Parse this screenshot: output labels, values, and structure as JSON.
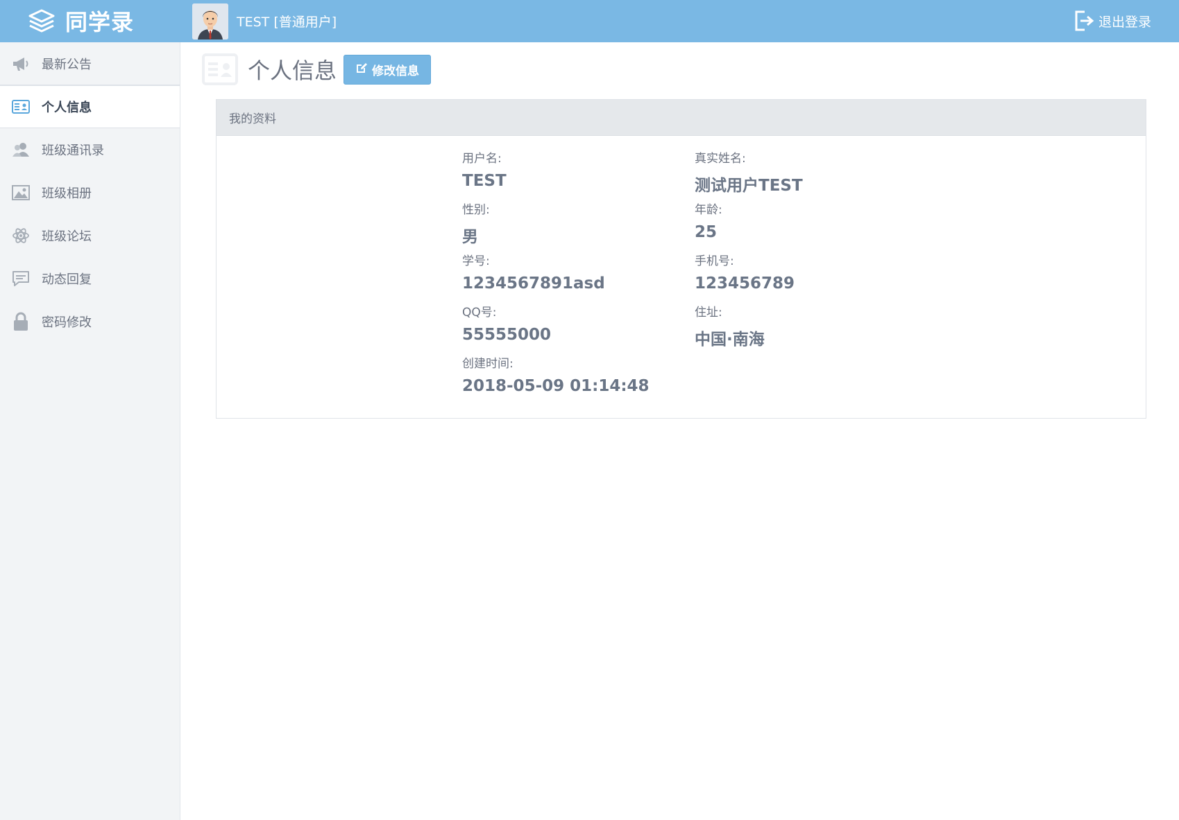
{
  "app": {
    "name": "同学录"
  },
  "header": {
    "user_label": "TEST [普通用户]",
    "logout_label": "退出登录"
  },
  "sidebar": {
    "items": [
      {
        "label": "最新公告",
        "icon": "megaphone-icon"
      },
      {
        "label": "个人信息",
        "icon": "id-card-icon",
        "active": true
      },
      {
        "label": "班级通讯录",
        "icon": "users-icon"
      },
      {
        "label": "班级相册",
        "icon": "image-icon"
      },
      {
        "label": "班级论坛",
        "icon": "atom-icon"
      },
      {
        "label": "动态回复",
        "icon": "comment-icon"
      },
      {
        "label": "密码修改",
        "icon": "lock-icon"
      }
    ]
  },
  "page": {
    "title": "个人信息",
    "edit_button": "修改信息"
  },
  "panel": {
    "title": "我的资料",
    "fields": {
      "username": {
        "label": "用户名:",
        "value": "TEST"
      },
      "realname": {
        "label": "真实姓名:",
        "value": "测试用户TEST"
      },
      "gender": {
        "label": "性别:",
        "value": "男"
      },
      "age": {
        "label": "年龄:",
        "value": "25"
      },
      "student_id": {
        "label": "学号:",
        "value": "1234567891asd"
      },
      "phone": {
        "label": "手机号:",
        "value": "123456789"
      },
      "qq": {
        "label": "QQ号:",
        "value": "55555000"
      },
      "address": {
        "label": "住址:",
        "value": "中国·南海"
      },
      "created": {
        "label": "创建时间:",
        "value": "2018-05-09 01:14:48"
      }
    }
  },
  "colors": {
    "accent": "#7ab8e4",
    "sidebar_bg": "#f2f4f6",
    "text": "#6b7280"
  }
}
